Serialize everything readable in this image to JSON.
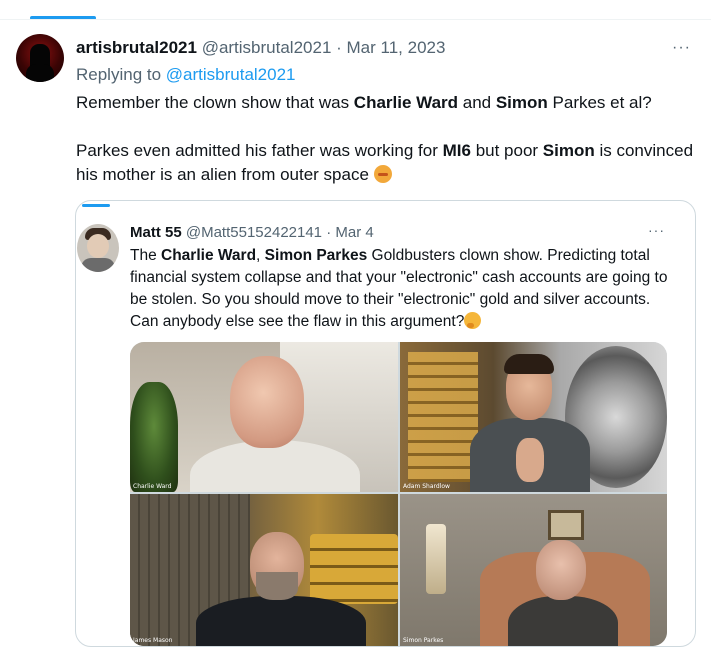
{
  "tweet": {
    "display_name": "artisbrutal2021",
    "handle": "@artisbrutal2021",
    "separator": " · ",
    "date": "Mar 11, 2023",
    "replying_prefix": "Replying to ",
    "replying_to": "@artisbrutal2021",
    "more_label": "···",
    "line1_a": "Remember the clown show that was ",
    "line1_b": "Charlie Ward",
    "line1_c": " and ",
    "line1_d": "Simon",
    "line1_e": " Parkes et al?",
    "line2_a": "Parkes even admitted his father was working for ",
    "line2_b": "MI6",
    "line2_c": " but poor ",
    "line2_d": "Simon",
    "line2_e": " is convinced his mother is an alien from outer space ",
    "emoji_name": "person-facepalming-emoji"
  },
  "quote": {
    "display_name": "Matt 55",
    "handle": "@Matt55152422141",
    "separator": " · ",
    "date": "Mar 4",
    "more_label": "···",
    "text_a": "The ",
    "text_b": "Charlie Ward",
    "text_c": ", ",
    "text_d": "Simon Parkes",
    "text_e": " Goldbusters clown show. Predicting total financial system collapse and that your \"electronic\" cash accounts are going to be stolen. So you should move to their \"electronic\" gold and silver accounts. Can anybody else see the flaw in this argument?",
    "emoji_name": "thinking-face-emoji"
  },
  "media": {
    "panels": [
      {
        "label": "Charlie Ward"
      },
      {
        "label": "Adam Shardlow"
      },
      {
        "label": "James Mason"
      },
      {
        "label": "Simon Parkes"
      }
    ]
  },
  "colors": {
    "accent": "#1d9bf0",
    "text": "#0f1419",
    "muted": "#536471",
    "border": "#cfd9de"
  }
}
